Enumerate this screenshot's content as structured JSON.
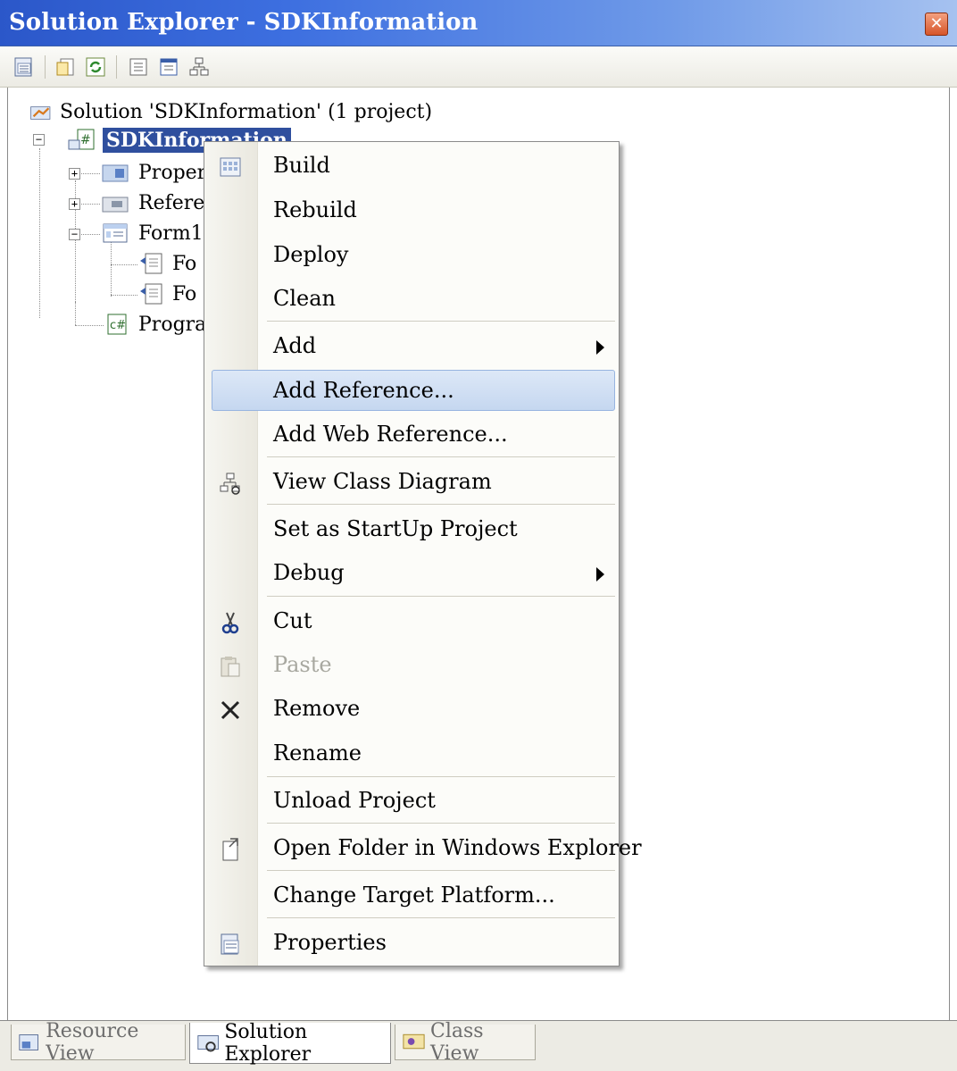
{
  "window": {
    "title": "Solution Explorer - SDKInformation",
    "close_glyph": "✕"
  },
  "toolbar": {
    "buttons": [
      "properties-icon",
      "show-all-files-icon",
      "refresh-icon",
      "view-code-icon",
      "view-designer-icon",
      "view-class-diagram-icon"
    ]
  },
  "tree": {
    "solution_label": "Solution 'SDKInformation' (1 project)",
    "project_label": "SDKInformation",
    "properties_label": "Proper",
    "references_label": "Refere",
    "form1_label": "Form1",
    "form1_designer_label": "Fo",
    "form1_resx_label": "Fo",
    "program_label": "Progra"
  },
  "context_menu": {
    "items": [
      {
        "label": "Build",
        "icon": "build-icon"
      },
      {
        "label": "Rebuild"
      },
      {
        "label": "Deploy"
      },
      {
        "label": "Clean"
      },
      {
        "label": "Add",
        "submenu": true
      },
      {
        "label": "Add Reference...",
        "highlighted": true
      },
      {
        "label": "Add Web Reference..."
      },
      {
        "label": "View Class Diagram",
        "icon": "class-diagram-icon"
      },
      {
        "label": "Set as StartUp Project"
      },
      {
        "label": "Debug",
        "submenu": true
      },
      {
        "label": "Cut",
        "icon": "scissors-icon"
      },
      {
        "label": "Paste",
        "icon": "paste-icon",
        "disabled": true
      },
      {
        "label": "Remove",
        "icon": "remove-x-icon"
      },
      {
        "label": "Rename"
      },
      {
        "label": "Unload Project"
      },
      {
        "label": "Open Folder in Windows Explorer",
        "icon": "open-folder-icon"
      },
      {
        "label": "Change Target Platform..."
      },
      {
        "label": "Properties",
        "icon": "properties-icon"
      }
    ]
  },
  "tabs": [
    {
      "label": "Resource View",
      "active": false
    },
    {
      "label": "Solution Explorer",
      "active": true
    },
    {
      "label": "Class View",
      "active": false
    }
  ],
  "colors": {
    "title_bar": "#2b57c9",
    "selection": "#2f4f9e",
    "menu_highlight": "#c5d7f0"
  }
}
